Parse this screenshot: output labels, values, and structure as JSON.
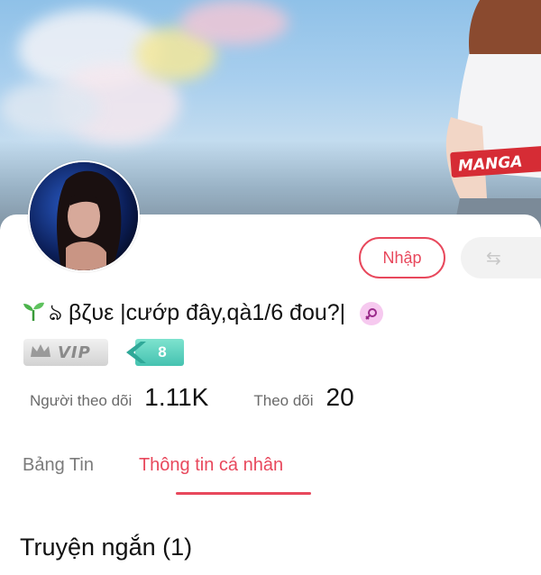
{
  "profile": {
    "display_name": "ঌ βζυε |cướp đây,qà1/6 đou?|",
    "vip_label": "VIP",
    "level": "8",
    "gender_icon": "female-icon"
  },
  "actions": {
    "import_label": "Nhập",
    "share_icon": "share-icon"
  },
  "stats": {
    "followers_label": "Người theo dõi",
    "followers_value": "1.11K",
    "following_label": "Theo dõi",
    "following_value": "20"
  },
  "tabs": [
    {
      "label": "Bảng Tin",
      "active": false
    },
    {
      "label": "Thông tin cá nhân",
      "active": true
    }
  ],
  "section": {
    "title": "Truyện ngắn (1)"
  },
  "colors": {
    "accent": "#e8485c",
    "level_badge": "#45c2b0"
  }
}
